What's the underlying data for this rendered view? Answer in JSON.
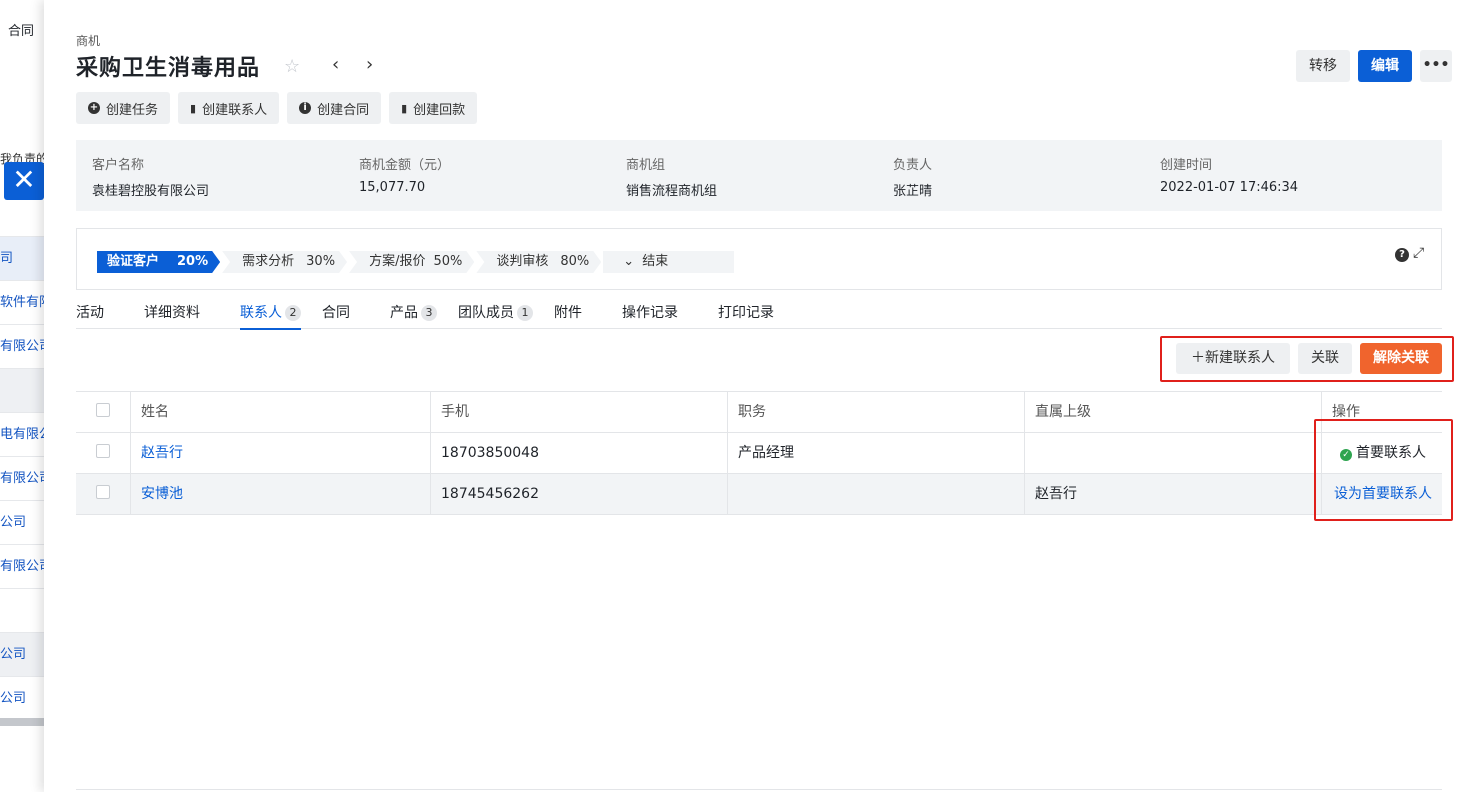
{
  "background_list": {
    "top_label": "合同",
    "header_text": "我负责的",
    "rows": [
      "司",
      "软件有限",
      "有限公司",
      "",
      "电有限公",
      "有限公司",
      "公司",
      "有限公司",
      "",
      "公司",
      "公司"
    ]
  },
  "header": {
    "breadcrumb": "商机",
    "title": "采购卫生消毒用品",
    "transfer_label": "转移",
    "edit_label": "编辑",
    "more_label": "•••"
  },
  "actions": [
    {
      "icon": "plus-circle-icon",
      "label": "创建任务"
    },
    {
      "icon": "clipboard-icon",
      "label": "创建联系人"
    },
    {
      "icon": "info-icon",
      "label": "创建合同"
    },
    {
      "icon": "clipboard-icon",
      "label": "创建回款"
    }
  ],
  "info": [
    {
      "label": "客户名称",
      "value": "袁桂碧控股有限公司"
    },
    {
      "label": "商机金额（元）",
      "value": "15,077.70"
    },
    {
      "label": "商机组",
      "value": "销售流程商机组"
    },
    {
      "label": "负责人",
      "value": "张芷晴"
    },
    {
      "label": "创建时间",
      "value": "2022-01-07 17:46:34"
    }
  ],
  "stages": [
    {
      "name": "验证客户",
      "pct": "20%",
      "active": true
    },
    {
      "name": "需求分析",
      "pct": "30%",
      "active": false
    },
    {
      "name": "方案/报价",
      "pct": "50%",
      "active": false
    },
    {
      "name": "谈判审核",
      "pct": "80%",
      "active": false
    },
    {
      "name": "结束",
      "pct": "",
      "active": false
    }
  ],
  "tabs": [
    {
      "label": "活动",
      "count": ""
    },
    {
      "label": "详细资料",
      "count": ""
    },
    {
      "label": "联系人",
      "count": "2"
    },
    {
      "label": "合同",
      "count": ""
    },
    {
      "label": "产品",
      "count": "3"
    },
    {
      "label": "团队成员",
      "count": "1"
    },
    {
      "label": "附件",
      "count": ""
    },
    {
      "label": "操作记录",
      "count": ""
    },
    {
      "label": "打印记录",
      "count": ""
    }
  ],
  "toolbar": {
    "new_contact": "新建联系人",
    "associate": "关联",
    "unassociate": "解除关联"
  },
  "table": {
    "columns": [
      "姓名",
      "手机",
      "职务",
      "直属上级",
      "操作"
    ],
    "rows": [
      {
        "name": "赵吾行",
        "phone": "18703850048",
        "title": "产品经理",
        "superior": "",
        "action": "首要联系人",
        "primary": true
      },
      {
        "name": "安博池",
        "phone": "18745456262",
        "title": "",
        "superior": "赵吾行",
        "action": "设为首要联系人",
        "primary": false
      }
    ]
  },
  "colors": {
    "accent": "#0b5fd6",
    "danger": "#f0642d",
    "highlight_box": "#e0201b",
    "success": "#2ea44f"
  }
}
